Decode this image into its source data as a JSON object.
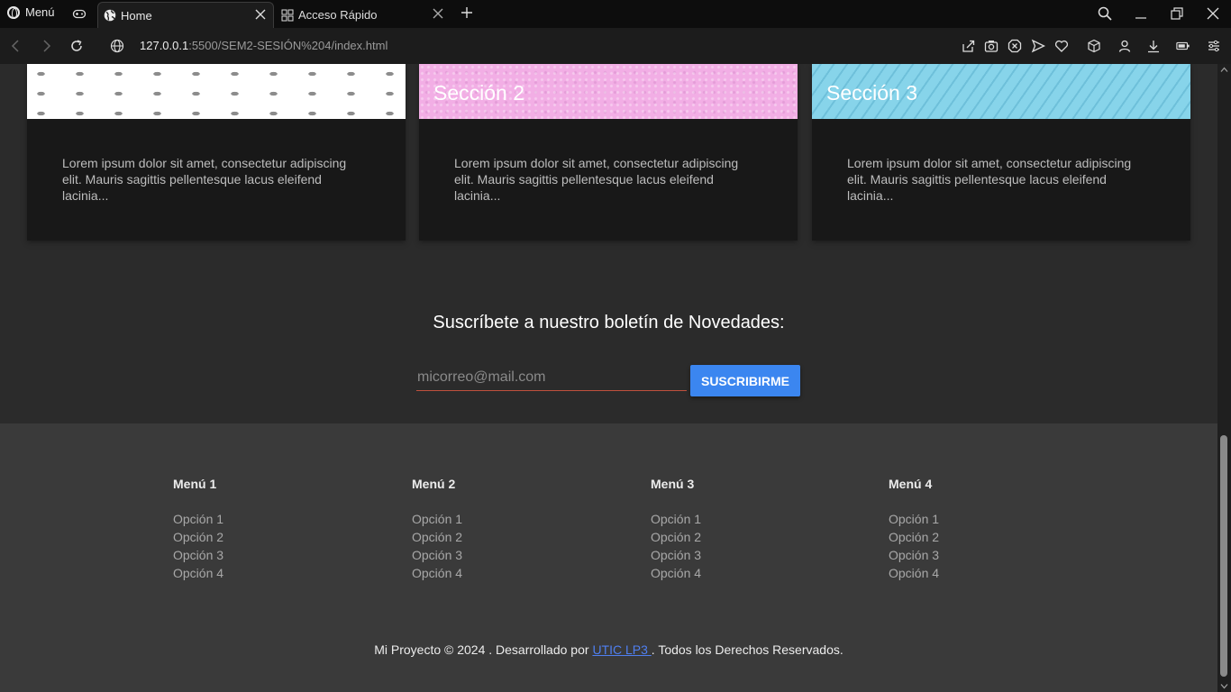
{
  "browser": {
    "menu_label": "Menú",
    "tabs": [
      {
        "title": "Home",
        "active": true
      },
      {
        "title": "Acceso Rápido",
        "active": false
      }
    ],
    "url_host": "127.0.0.1",
    "url_path": ":5500/SEM2-SESIÓN%204/index.html"
  },
  "sections": [
    {
      "title": "",
      "text": "Lorem ipsum dolor sit amet, consectetur adipiscing elit. Mauris sagittis pellentesque lacus eleifend lacinia..."
    },
    {
      "title": "Sección 2",
      "text": "Lorem ipsum dolor sit amet, consectetur adipiscing elit. Mauris sagittis pellentesque lacus eleifend lacinia..."
    },
    {
      "title": "Sección 3",
      "text": "Lorem ipsum dolor sit amet, consectetur adipiscing elit. Mauris sagittis pellentesque lacus eleifend lacinia..."
    }
  ],
  "newsletter": {
    "title": "Suscríbete a nuestro boletín de Novedades:",
    "placeholder": "micorreo@mail.com",
    "button": "SUSCRIBIRME"
  },
  "footer": {
    "menus": [
      {
        "title": "Menú 1",
        "items": [
          "Opción 1",
          "Opción 2",
          "Opción 3",
          "Opción 4"
        ]
      },
      {
        "title": "Menú 2",
        "items": [
          "Opción 1",
          "Opción 2",
          "Opción 3",
          "Opción 4"
        ]
      },
      {
        "title": "Menú 3",
        "items": [
          "Opción 1",
          "Opción 2",
          "Opción 3",
          "Opción 4"
        ]
      },
      {
        "title": "Menú 4",
        "items": [
          "Opción 1",
          "Opción 2",
          "Opción 3",
          "Opción 4"
        ]
      }
    ],
    "copyright_prefix": "Mi Proyecto © 2024 . Desarrollado por ",
    "copyright_link": "UTIC LP3 ",
    "copyright_suffix": ". Todos los Derechos Reservados."
  }
}
